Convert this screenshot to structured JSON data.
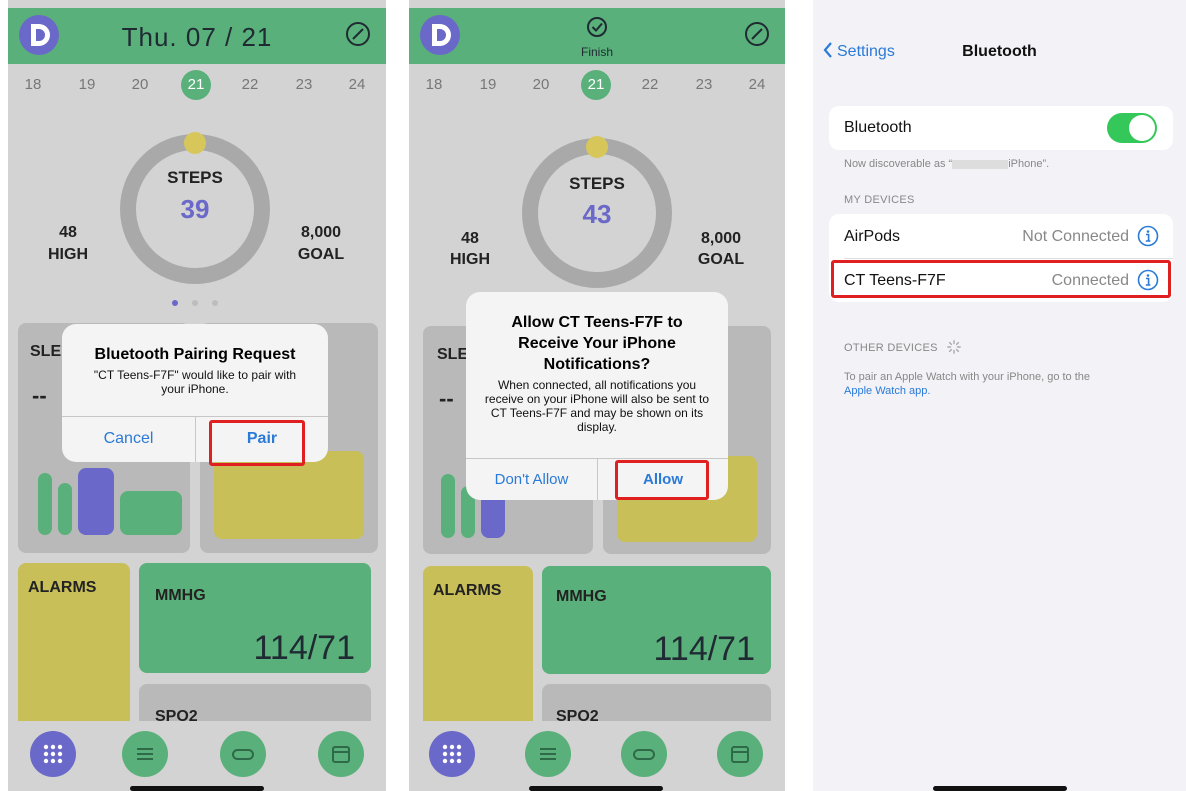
{
  "screen1": {
    "title": "Thu.  07  /  21",
    "days": [
      "18",
      "19",
      "20",
      "21",
      "22",
      "23",
      "24"
    ],
    "active_day": "21",
    "steps_label": "STEPS",
    "steps_value": "39",
    "high_value": "48",
    "high_label": "HIGH",
    "goal_value": "8,000",
    "goal_label": "GOAL",
    "sleep_label": "SLE",
    "sleep_value": "--",
    "alarms_label": "ALARMS",
    "mmhg_label": "MMHG",
    "bp_value": "114/71",
    "spo2_label": "SPO2",
    "dialog": {
      "title": "Bluetooth Pairing Request",
      "message": "\"CT Teens-F7F\" would like to pair with your iPhone.",
      "cancel": "Cancel",
      "pair": "Pair"
    }
  },
  "screen2": {
    "finish_label": "Finish",
    "days": [
      "18",
      "19",
      "20",
      "21",
      "22",
      "23",
      "24"
    ],
    "active_day": "21",
    "steps_label": "STEPS",
    "steps_value": "43",
    "high_value": "48",
    "high_label": "HIGH",
    "goal_value": "8,000",
    "goal_label": "GOAL",
    "sleep_label": "SLE",
    "sleep_value": "--",
    "alarms_label": "ALARMS",
    "mmhg_label": "MMHG",
    "bp_value": "114/71",
    "spo2_label": "SPO2",
    "dialog": {
      "title": "Allow CT Teens-F7F to Receive Your iPhone Notifications?",
      "message": "When connected, all notifications you receive on your iPhone will also be sent to CT Teens-F7F and may be shown on its display.",
      "dont_allow": "Don't Allow",
      "allow": "Allow"
    }
  },
  "screen3": {
    "back_label": "Settings",
    "title": "Bluetooth",
    "bluetooth_row": "Bluetooth",
    "bluetooth_on": true,
    "discoverable_prefix": "Now discoverable as “",
    "discoverable_suffix": "iPhone”.",
    "my_devices_header": "MY DEVICES",
    "devices": [
      {
        "name": "AirPods",
        "status": "Not Connected"
      },
      {
        "name": "CT Teens-F7F",
        "status": "Connected"
      }
    ],
    "other_devices_header": "OTHER DEVICES",
    "watch_note": "To pair an Apple Watch with your iPhone, go to the",
    "watch_link": "Apple Watch app."
  },
  "colors": {
    "app_green": "#5ab07a",
    "app_purple": "#6a68c8",
    "app_yellow": "#c8bf59",
    "ios_blue": "#2a7ad8",
    "ios_green": "#34c759",
    "highlight_red": "#e02020"
  },
  "icons": [
    "app-logo-icon",
    "edit-icon",
    "finish-check-icon",
    "grid-icon",
    "sliders-icon",
    "band-icon",
    "calendar-icon",
    "info-icon",
    "chevron-left-icon",
    "spinner-icon"
  ]
}
